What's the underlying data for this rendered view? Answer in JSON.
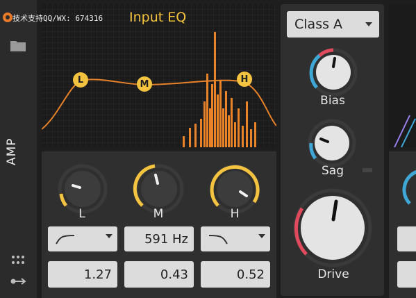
{
  "sidebar": {
    "section_label": "AMP",
    "folder_icon": "folder-icon",
    "grid_icon": "grid-dots-icon",
    "route_icon": "route-arrow-icon"
  },
  "watermark": "技术支持QQ/WX: 674316",
  "eq": {
    "title": "Input EQ",
    "nodes": {
      "low": "L",
      "mid": "M",
      "high": "H"
    },
    "knobs": {
      "low": "L",
      "mid": "M",
      "high": "H"
    },
    "freq_value": "591 Hz",
    "gain_values": {
      "low": "1.27",
      "mid": "0.43",
      "high": "0.52"
    }
  },
  "amp": {
    "class_select": "Class A",
    "knobs": {
      "bias": "Bias",
      "sag": "Sag",
      "drive": "Drive"
    }
  },
  "colors": {
    "accent_yellow": "#f4c33f",
    "curve_orange": "#e8832a",
    "red_arc": "#e04a5c",
    "blue_arc": "#3fa7d6"
  }
}
